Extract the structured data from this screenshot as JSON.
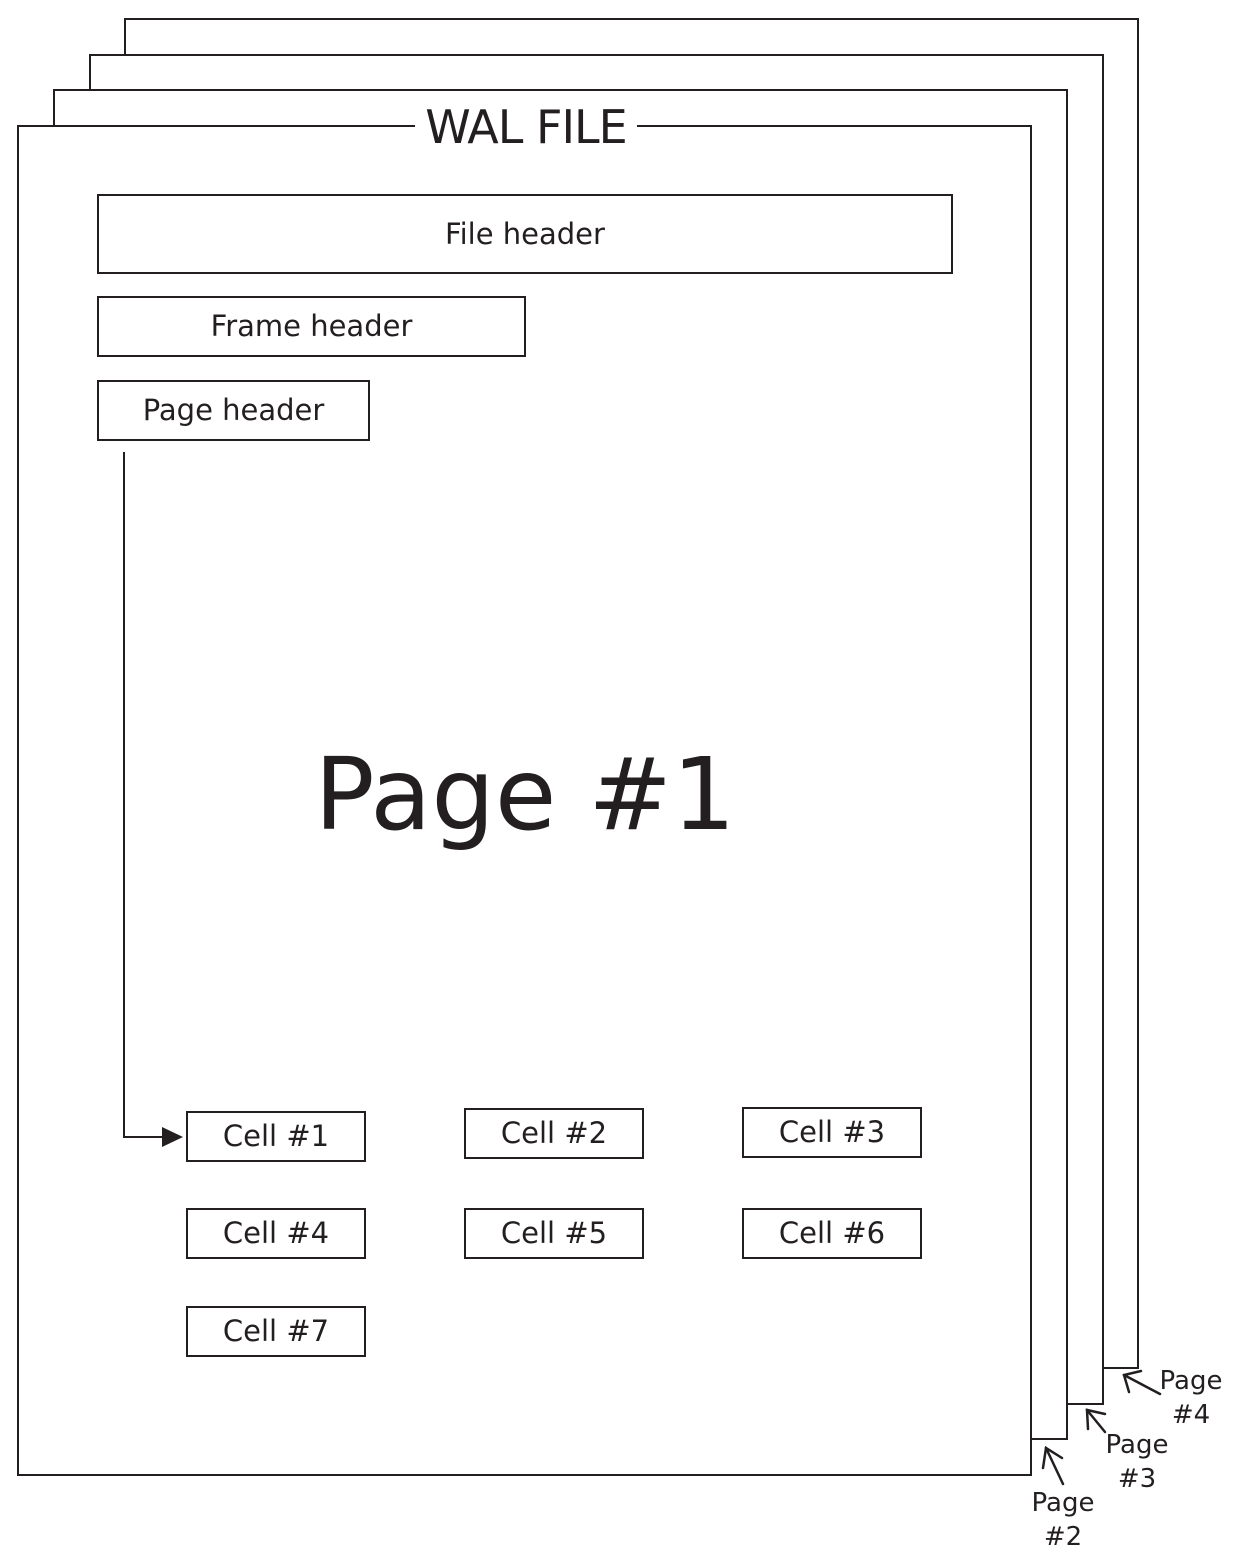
{
  "diagram": {
    "title": "WAL FILE",
    "main_page_label": "Page #1",
    "headers": {
      "file": "File header",
      "frame": "Frame header",
      "page": "Page header"
    },
    "cells": [
      "Cell #1",
      "Cell #2",
      "Cell #3",
      "Cell #4",
      "Cell #5",
      "Cell #6",
      "Cell #7"
    ],
    "stacked_pages": [
      {
        "word": "Page",
        "number": "#2"
      },
      {
        "word": "Page",
        "number": "#3"
      },
      {
        "word": "Page",
        "number": "#4"
      }
    ]
  },
  "colors": {
    "stroke": "#231f20",
    "background": "#ffffff"
  }
}
